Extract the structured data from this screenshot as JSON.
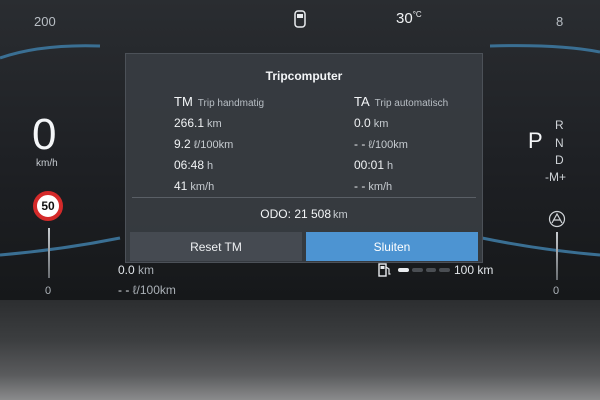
{
  "cluster": {
    "top_left_value": "200",
    "top_right_value": "8",
    "temperature_value": "30",
    "temperature_unit": "°C",
    "speed": "0",
    "speed_unit": "km/h",
    "speed_limit": "50",
    "left_gauge_min": "0",
    "right_gauge_min": "0",
    "gear_selected": "P",
    "gear_options": [
      "R",
      "N",
      "D",
      "-M+"
    ]
  },
  "bottom": {
    "distance_value": "0.0",
    "distance_unit": "km",
    "consumption_value": "- -",
    "consumption_unit": "ℓ/100km",
    "range_value": "100",
    "range_unit": "km",
    "range_level": 0.25
  },
  "trip": {
    "title": "Tripcomputer",
    "manual": {
      "code": "TM",
      "label": "Trip handmatig",
      "distance": "266.1",
      "distance_unit": "km",
      "consumption": "9.2",
      "consumption_unit": "ℓ/100km",
      "time": "06:48",
      "time_unit": "h",
      "speed": "41",
      "speed_unit": "km/h"
    },
    "auto": {
      "code": "TA",
      "label": "Trip automatisch",
      "distance": "0.0",
      "distance_unit": "km",
      "consumption": "- -",
      "consumption_unit": "ℓ/100km",
      "time": "00:01",
      "time_unit": "h",
      "speed": "- -",
      "speed_unit": "km/h"
    },
    "odo_label": "ODO:",
    "odo_value": "21 508",
    "odo_unit": "km",
    "reset_label": "Reset TM",
    "close_label": "Sluiten"
  },
  "colors": {
    "accent": "#4d94d2",
    "speed_limit_ring": "#d42a2a"
  }
}
